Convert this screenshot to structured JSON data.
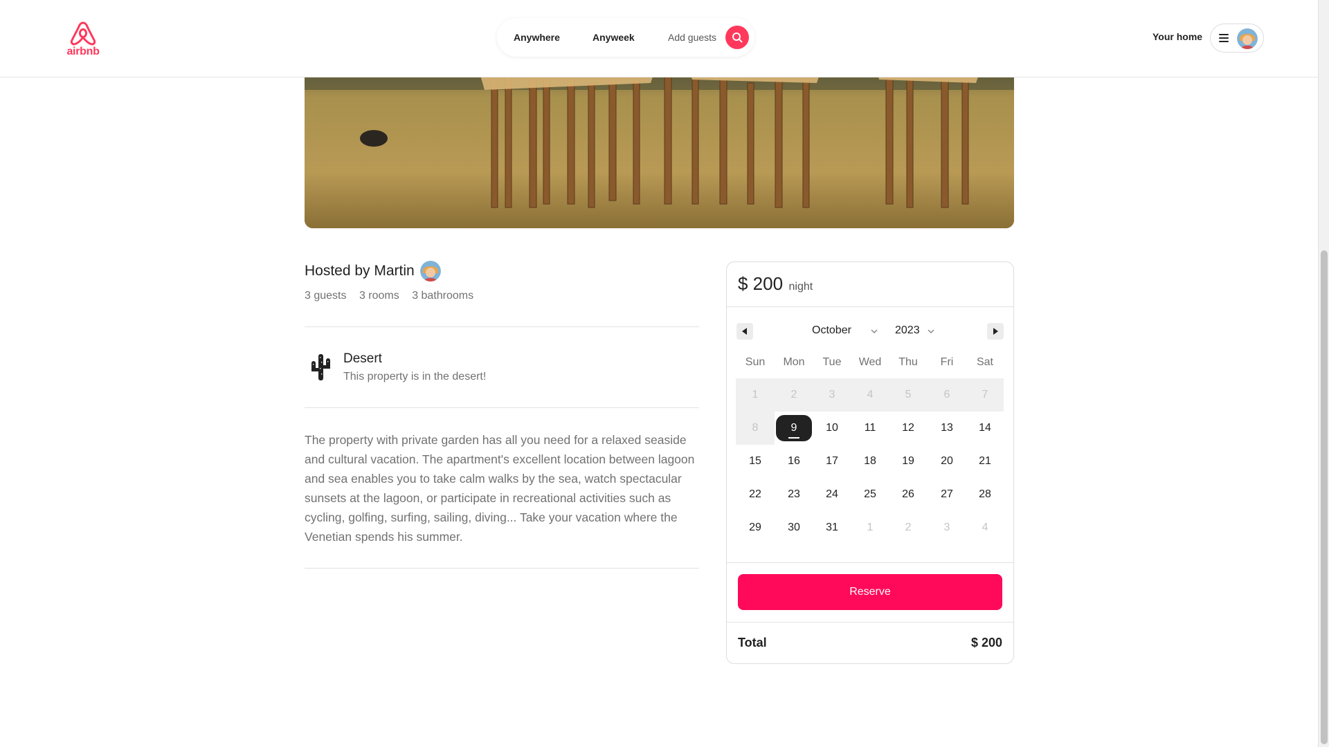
{
  "header": {
    "logo_text": "airbnb",
    "search": {
      "anywhere": "Anywhere",
      "anyweek": "Anyweek",
      "guests": "Add guests"
    },
    "your_home": "Your home"
  },
  "colors": {
    "brand": "#ff385c",
    "reserve": "#ff0a5a"
  },
  "listing": {
    "host_title": "Hosted by Martin",
    "meta": [
      "3 guests",
      "3 rooms",
      "3 bathrooms"
    ],
    "feature": {
      "icon": "cactus-icon",
      "title": "Desert",
      "description": "This property is in the desert!"
    },
    "description": "The property with private garden has all you need for a relaxed seaside and cultural vacation. The apartment's excellent location between lagoon and sea enables you to take calm walks by the sea, watch spectacular sunsets at the lagoon, or participate in recreational activities such as cycling, golfing, surfing, sailing, diving... Take your vacation where the Venetian spends his summer."
  },
  "booking": {
    "price": "$ 200",
    "price_unit": "night",
    "calendar": {
      "month": "October",
      "year": "2023",
      "weekdays": [
        "Sun",
        "Mon",
        "Tue",
        "Wed",
        "Thu",
        "Fri",
        "Sat"
      ],
      "weeks": [
        [
          {
            "d": "1",
            "state": "past"
          },
          {
            "d": "2",
            "state": "past"
          },
          {
            "d": "3",
            "state": "past"
          },
          {
            "d": "4",
            "state": "past"
          },
          {
            "d": "5",
            "state": "past"
          },
          {
            "d": "6",
            "state": "past"
          },
          {
            "d": "7",
            "state": "past"
          }
        ],
        [
          {
            "d": "8",
            "state": "past"
          },
          {
            "d": "9",
            "state": "selected"
          },
          {
            "d": "10",
            "state": "normal"
          },
          {
            "d": "11",
            "state": "normal"
          },
          {
            "d": "12",
            "state": "normal"
          },
          {
            "d": "13",
            "state": "normal"
          },
          {
            "d": "14",
            "state": "normal"
          }
        ],
        [
          {
            "d": "15",
            "state": "normal"
          },
          {
            "d": "16",
            "state": "normal"
          },
          {
            "d": "17",
            "state": "normal"
          },
          {
            "d": "18",
            "state": "normal"
          },
          {
            "d": "19",
            "state": "normal"
          },
          {
            "d": "20",
            "state": "normal"
          },
          {
            "d": "21",
            "state": "normal"
          }
        ],
        [
          {
            "d": "22",
            "state": "normal"
          },
          {
            "d": "23",
            "state": "normal"
          },
          {
            "d": "24",
            "state": "normal"
          },
          {
            "d": "25",
            "state": "normal"
          },
          {
            "d": "26",
            "state": "normal"
          },
          {
            "d": "27",
            "state": "normal"
          },
          {
            "d": "28",
            "state": "normal"
          }
        ],
        [
          {
            "d": "29",
            "state": "normal"
          },
          {
            "d": "30",
            "state": "normal"
          },
          {
            "d": "31",
            "state": "normal"
          },
          {
            "d": "1",
            "state": "outside"
          },
          {
            "d": "2",
            "state": "outside"
          },
          {
            "d": "3",
            "state": "outside"
          },
          {
            "d": "4",
            "state": "outside"
          }
        ]
      ]
    },
    "reserve_label": "Reserve",
    "total_label": "Total",
    "total_value": "$ 200"
  }
}
